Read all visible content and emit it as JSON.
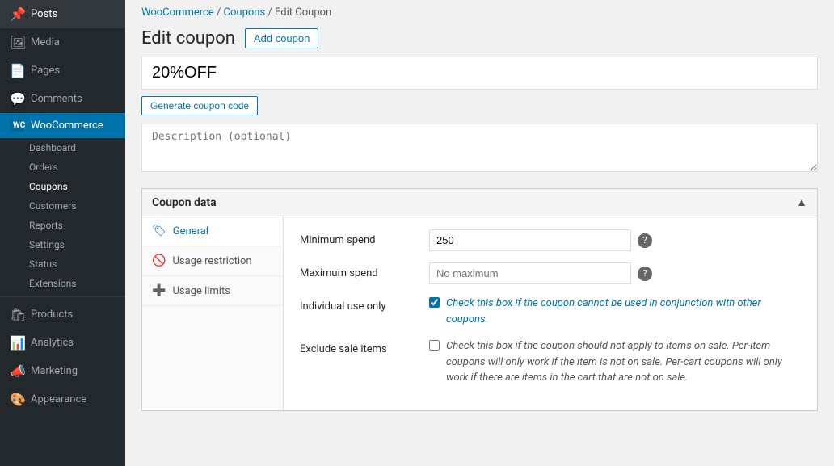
{
  "sidebar": {
    "items": [
      {
        "id": "posts",
        "label": "Posts",
        "icon": "📌",
        "active": false
      },
      {
        "id": "media",
        "label": "Media",
        "icon": "🖼",
        "active": false
      },
      {
        "id": "pages",
        "label": "Pages",
        "icon": "📄",
        "active": false
      },
      {
        "id": "comments",
        "label": "Comments",
        "icon": "💬",
        "active": false
      },
      {
        "id": "woocommerce",
        "label": "WooCommerce",
        "icon": "WC",
        "active": true
      },
      {
        "id": "products",
        "label": "Products",
        "icon": "🛍",
        "active": false
      },
      {
        "id": "analytics",
        "label": "Analytics",
        "icon": "📊",
        "active": false
      },
      {
        "id": "marketing",
        "label": "Marketing",
        "icon": "📣",
        "active": false
      },
      {
        "id": "appearance",
        "label": "Appearance",
        "icon": "🎨",
        "active": false
      }
    ],
    "woo_sub_items": [
      {
        "id": "dashboard",
        "label": "Dashboard",
        "active": false
      },
      {
        "id": "orders",
        "label": "Orders",
        "active": false
      },
      {
        "id": "coupons",
        "label": "Coupons",
        "active": true
      },
      {
        "id": "customers",
        "label": "Customers",
        "active": false
      },
      {
        "id": "reports",
        "label": "Reports",
        "active": false
      },
      {
        "id": "settings",
        "label": "Settings",
        "active": false
      },
      {
        "id": "status",
        "label": "Status",
        "active": false
      },
      {
        "id": "extensions",
        "label": "Extensions",
        "active": false
      }
    ]
  },
  "breadcrumb": {
    "woocommerce": "WooCommerce",
    "coupons": "Coupons",
    "current": "Edit Coupon"
  },
  "page": {
    "title": "Edit coupon",
    "add_button": "Add coupon",
    "coupon_code": "20%OFF",
    "generate_button": "Generate coupon code",
    "description_placeholder": "Description (optional)"
  },
  "coupon_data": {
    "title": "Coupon data",
    "tabs": [
      {
        "id": "general",
        "label": "General",
        "icon": "🏷",
        "active": true
      },
      {
        "id": "usage_restriction",
        "label": "Usage restriction",
        "icon": "🚫",
        "active": false
      },
      {
        "id": "usage_limits",
        "label": "Usage limits",
        "icon": "➕",
        "active": false
      }
    ],
    "fields": {
      "minimum_spend": {
        "label": "Minimum spend",
        "value": "250"
      },
      "maximum_spend": {
        "label": "Maximum spend",
        "placeholder": "No maximum"
      },
      "individual_use": {
        "label": "Individual use only",
        "checked": true,
        "description": "Check this box if the coupon cannot be used in conjunction with other coupons."
      },
      "exclude_sale_items": {
        "label": "Exclude sale items",
        "checked": false,
        "description": "Check this box if the coupon should not apply to items on sale. Per-item coupons will only work if the item is not on sale. Per-cart coupons will only work if there are items in the cart that are not on sale."
      }
    }
  }
}
